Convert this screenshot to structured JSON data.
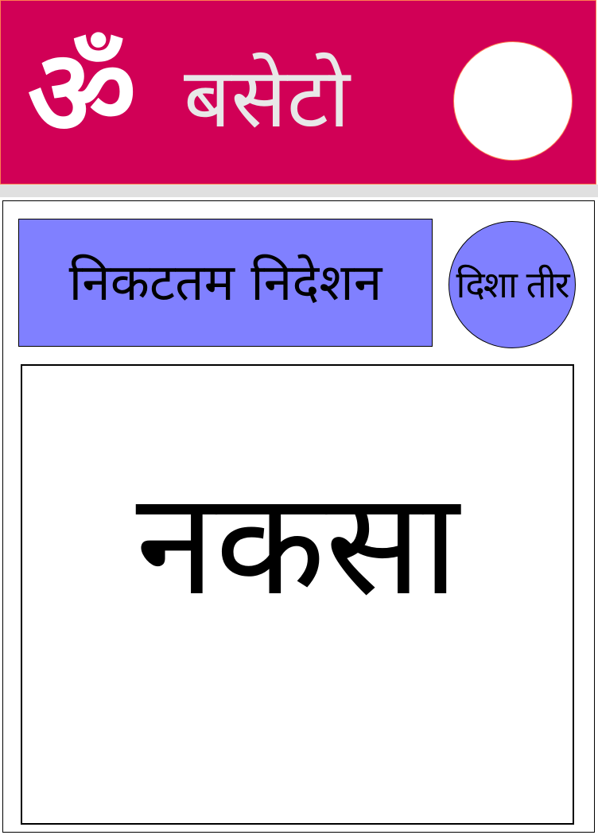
{
  "colors": {
    "header_bg": "#d10056",
    "header_divider": "#e0e0e0",
    "button_bg": "#8080ff",
    "circle_fill": "#ffffff",
    "text_dark": "#000000",
    "text_light": "#e8e8e8"
  },
  "header": {
    "logo_icon": "om-icon",
    "logo_glyph": "ॐ",
    "title": "बसेटो"
  },
  "controls": {
    "nearest_label": "निकटतम निदेशन",
    "direction_label": "दिशा तीर"
  },
  "map": {
    "label": "नकसा"
  }
}
